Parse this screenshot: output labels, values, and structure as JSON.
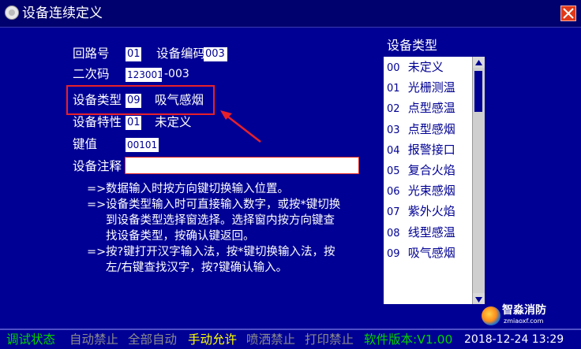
{
  "window": {
    "title": "设备连续定义",
    "app_icon": "circle-icon",
    "close_icon": "close-x-icon"
  },
  "form": {
    "loop_label": "回路号",
    "loop_value": "01",
    "device_code_label": "设备编码",
    "device_code_value": "003",
    "secondary_label": "二次码",
    "secondary_value": "123001",
    "secondary_suffix": "-003",
    "type_label": "设备类型",
    "type_value": "09",
    "type_name": "吸气感烟",
    "property_label": "设备特性",
    "property_value": "01",
    "property_name": "未定义",
    "key_label": "键值",
    "key_value": "00101",
    "remark_label": "设备注释",
    "remark_value": ""
  },
  "notes": [
    {
      "prefix": "=>",
      "text": "数据输入时按方向键切换输入位置。"
    },
    {
      "prefix": "=>",
      "text": "设备类型输入时可直接输入数字，或按*键切换"
    },
    {
      "prefix": "",
      "text": "到设备类型选择窗选择。选择窗内按方向键查"
    },
    {
      "prefix": "",
      "text": "找设备类型，按确认键返回。"
    },
    {
      "prefix": "=>",
      "text": "按?键打开汉字输入法，按*键切换输入法，按"
    },
    {
      "prefix": "",
      "text": "左/右键查找汉字，按?键确认输入。"
    }
  ],
  "type_panel": {
    "title": "设备类型",
    "items": [
      {
        "code": "00",
        "name": "未定义"
      },
      {
        "code": "01",
        "name": "光栅测温"
      },
      {
        "code": "02",
        "name": "点型感温"
      },
      {
        "code": "03",
        "name": "点型感烟"
      },
      {
        "code": "04",
        "name": "报警接口"
      },
      {
        "code": "05",
        "name": "复合火焰"
      },
      {
        "code": "06",
        "name": "光束感烟"
      },
      {
        "code": "07",
        "name": "紫外火焰"
      },
      {
        "code": "08",
        "name": "线型感温"
      },
      {
        "code": "09",
        "name": "吸气感烟"
      }
    ]
  },
  "watermark": {
    "brand": "智淼消防",
    "url": "zmiaoxf.com"
  },
  "status": {
    "debug": "调试状态",
    "auto_forbid": "自动禁止",
    "all_auto": "全部自动",
    "manual_allow": "手动允许",
    "spray_forbid": "喷洒禁止",
    "print_forbid": "打印禁止",
    "version": "软件版本:V1.00",
    "datetime": "2018-12-24 13:29"
  },
  "colors": {
    "background": "#000094",
    "highlight": "#e8202a",
    "status_green": "#00d400",
    "status_gray": "#8b8b8b",
    "status_yellow": "#ffff00"
  }
}
